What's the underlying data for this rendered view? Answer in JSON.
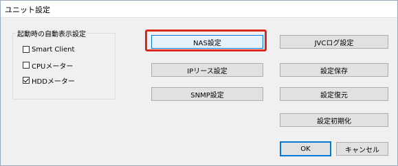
{
  "window": {
    "title": "ユニット設定"
  },
  "startup_group": {
    "legend": "起動時の自動表示設定",
    "options": [
      {
        "label": "Smart Client",
        "checked": false
      },
      {
        "label": "CPUメーター",
        "checked": false
      },
      {
        "label": "HDDメーター",
        "checked": true
      }
    ]
  },
  "buttons": {
    "nas": "NAS設定",
    "ip_source": "IPリース設定",
    "snmp": "SNMP設定",
    "jvc_log": "JVCログ設定",
    "save": "設定保存",
    "restore": "設定復元",
    "init": "設定初期化",
    "ok": "OK",
    "cancel": "キャンセル"
  },
  "colors": {
    "highlight": "#d9291c",
    "focus_border": "#0078d7",
    "focus_bg": "#e5f1fb"
  }
}
